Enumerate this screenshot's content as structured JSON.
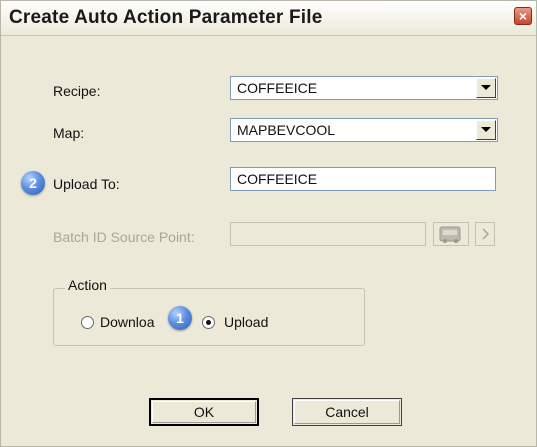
{
  "window": {
    "title": "Create Auto Action Parameter File",
    "close_glyph": "×"
  },
  "form": {
    "recipe_label": "Recipe:",
    "recipe_value": "COFFEEICE",
    "map_label": "Map:",
    "map_value": "MAPBEVCOOL",
    "upload_to_label": "Upload To:",
    "upload_to_value": "COFFEEICE",
    "batch_id_label": "Batch ID Source Point:",
    "batch_id_value": ""
  },
  "action_group": {
    "legend": "Action",
    "options": [
      {
        "label": "Downloa",
        "selected": false
      },
      {
        "label": "Upload",
        "selected": true
      }
    ]
  },
  "callouts": {
    "step1": "1",
    "step2": "2"
  },
  "buttons": {
    "ok": "OK",
    "cancel": "Cancel"
  },
  "colors": {
    "dialog_bg": "#ece9d8",
    "callout_blue": "#3f6fcf",
    "close_red": "#c4472d"
  }
}
